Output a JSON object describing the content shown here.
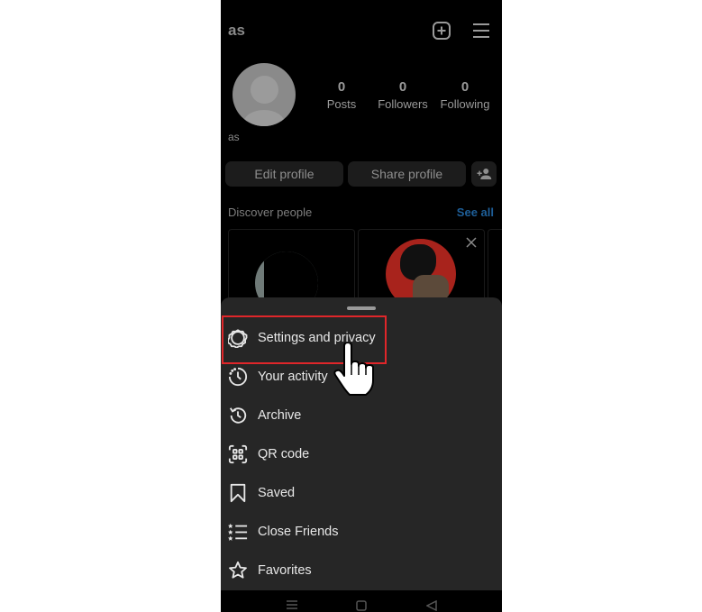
{
  "header": {
    "username": "as",
    "create_icon": "plus-square-icon",
    "menu_icon": "hamburger-menu-icon"
  },
  "profile": {
    "display_name": "as",
    "stats": [
      {
        "value": "0",
        "label": "Posts"
      },
      {
        "value": "0",
        "label": "Followers"
      },
      {
        "value": "0",
        "label": "Following"
      }
    ],
    "edit_profile_label": "Edit profile",
    "share_profile_label": "Share profile",
    "add_person_icon": "add-person-icon"
  },
  "discover": {
    "title": "Discover people",
    "see_all_label": "See all",
    "close_icon": "close-icon"
  },
  "sheet": {
    "items": [
      {
        "label": "Settings and privacy",
        "icon": "settings-icon"
      },
      {
        "label": "Your activity",
        "icon": "activity-icon"
      },
      {
        "label": "Archive",
        "icon": "archive-icon"
      },
      {
        "label": "QR code",
        "icon": "qr-code-icon"
      },
      {
        "label": "Saved",
        "icon": "bookmark-icon"
      },
      {
        "label": "Close Friends",
        "icon": "close-friends-icon"
      },
      {
        "label": "Favorites",
        "icon": "star-icon"
      }
    ]
  },
  "colors": {
    "highlight": "#e0262a",
    "link": "#1e5f99",
    "sheet_bg": "#262626"
  }
}
